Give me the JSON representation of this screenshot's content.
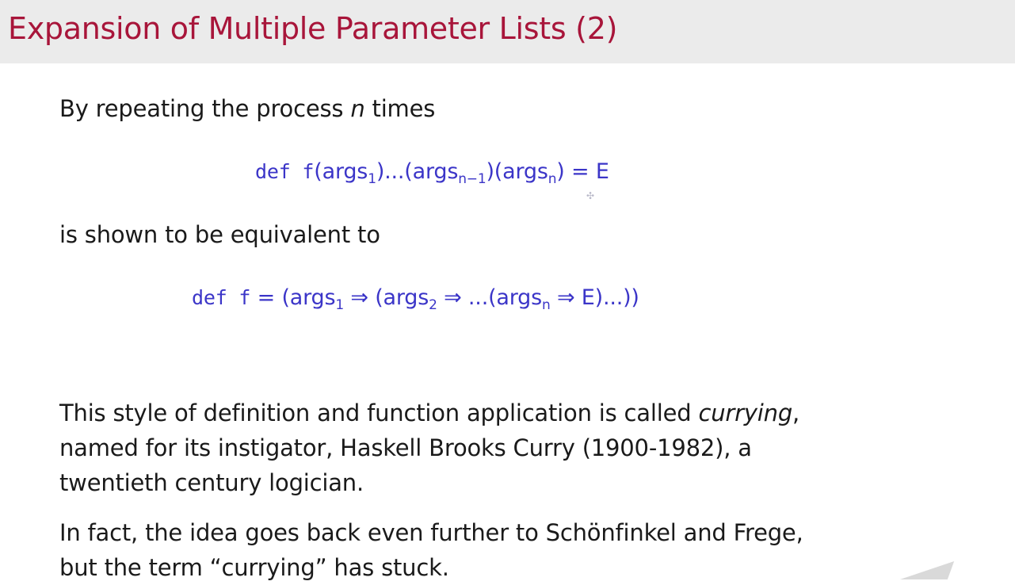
{
  "slide": {
    "title": "Expansion of Multiple Parameter Lists (2)",
    "intro": {
      "before": "By repeating the process ",
      "var": "n",
      "after": " times"
    },
    "code1": {
      "kw": "def f",
      "p1": "(args",
      "s1": "1",
      "p2": ")...(args",
      "s2": "n−1",
      "p3": ")(args",
      "s3": "n",
      "p4": ") = E"
    },
    "equiv": "is shown to be equivalent to",
    "code2": {
      "kw": "def f",
      "p1": " = (args",
      "s1": "1",
      "p2": " ⇒ (args",
      "s2": "2",
      "p3": " ⇒ ...(args",
      "s3": "n",
      "p4": " ⇒ E)...))"
    },
    "para1": {
      "l1_before": "This style of definition and function application is called ",
      "l1_em": "currying",
      "l1_after": ",",
      "l2": "named for its instigator, Haskell Brooks Curry (1900-1982), a",
      "l3": "twentieth century logician."
    },
    "para2": {
      "l1": "In fact, the idea goes back even further to Schönfinkel and Frege,",
      "l2": "but the term “currying” has stuck."
    }
  }
}
